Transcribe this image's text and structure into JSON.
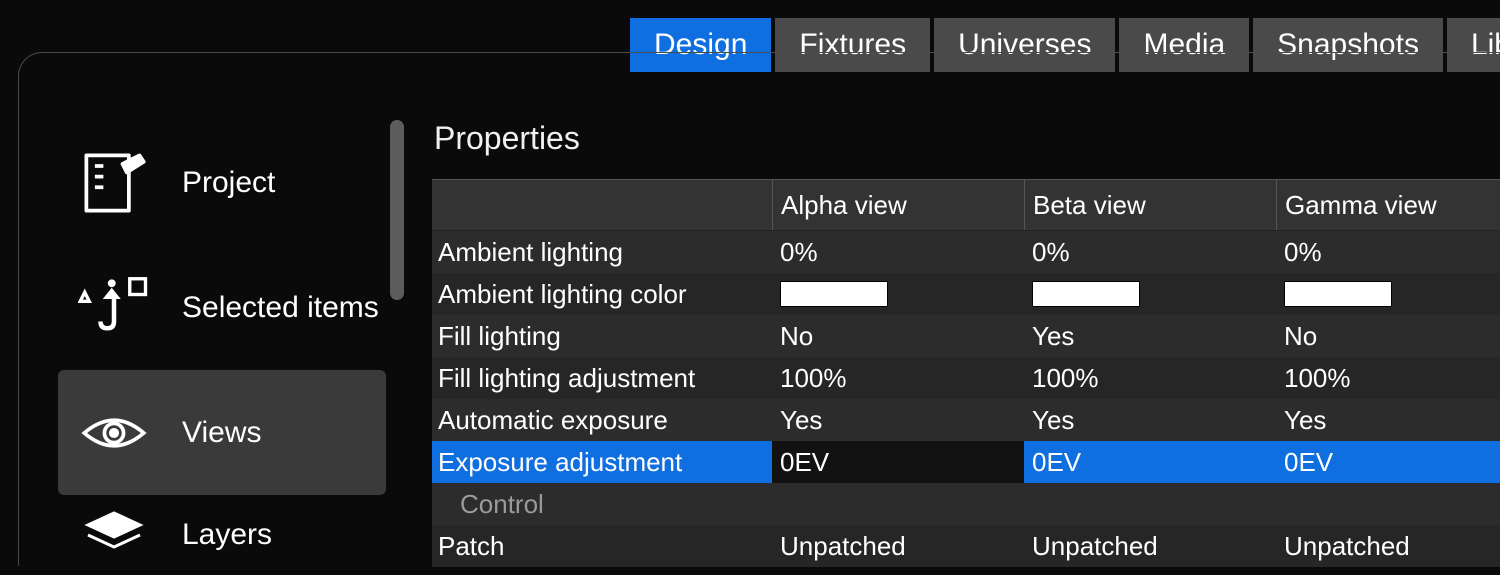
{
  "tabs": {
    "items": [
      "Design",
      "Fixtures",
      "Universes",
      "Media",
      "Snapshots",
      "Lib"
    ],
    "active_index": 0
  },
  "sidebar": {
    "items": [
      {
        "label": "Project"
      },
      {
        "label": "Selected items"
      },
      {
        "label": "Views"
      },
      {
        "label": "Layers"
      }
    ],
    "active_index": 2
  },
  "main": {
    "title": "Properties",
    "columns": [
      "",
      "Alpha view",
      "Beta view",
      "Gamma view"
    ],
    "rows": [
      {
        "label": "Ambient lighting",
        "values": [
          "0%",
          "0%",
          "0%"
        ]
      },
      {
        "label": "Ambient lighting color",
        "values": [
          "#ffffff",
          "#ffffff",
          "#ffffff"
        ],
        "type": "color"
      },
      {
        "label": "Fill lighting",
        "values": [
          "No",
          "Yes",
          "No"
        ]
      },
      {
        "label": "Fill lighting adjustment",
        "values": [
          "100%",
          "100%",
          "100%"
        ]
      },
      {
        "label": "Automatic exposure",
        "values": [
          "Yes",
          "Yes",
          "Yes"
        ]
      },
      {
        "label": "Exposure adjustment",
        "values": [
          "0EV",
          "0EV",
          "0EV"
        ],
        "selected": true,
        "editing_col": 0
      }
    ],
    "section": "Control",
    "rows2": [
      {
        "label": "Patch",
        "values": [
          "Unpatched",
          "Unpatched",
          "Unpatched"
        ]
      }
    ]
  }
}
